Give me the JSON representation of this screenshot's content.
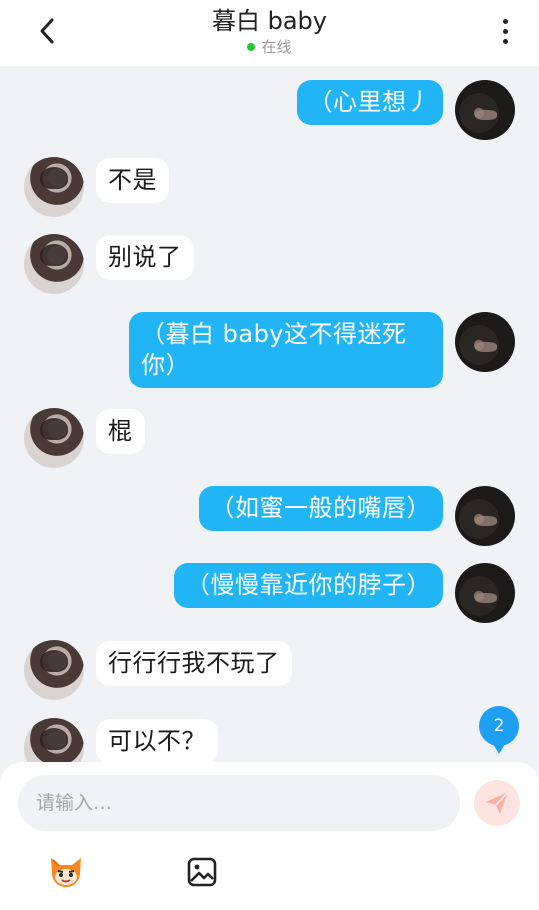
{
  "header": {
    "title": "暮白 baby",
    "status": "在线"
  },
  "messages": [
    {
      "side": "right",
      "text": "（心里想丿"
    },
    {
      "side": "left",
      "text": "不是"
    },
    {
      "side": "left",
      "text": "别说了"
    },
    {
      "side": "right",
      "line1": "（暮白 baby这不得迷死",
      "line2": "你）"
    },
    {
      "side": "left",
      "text": "棍"
    },
    {
      "side": "right",
      "text": "（如蜜一般的嘴唇）"
    },
    {
      "side": "right",
      "text": "（慢慢靠近你的脖子）"
    },
    {
      "side": "left",
      "text": "行行行我不玩了"
    },
    {
      "side": "left",
      "text": "可以不？"
    }
  ],
  "unread_count": "2",
  "composer": {
    "placeholder": "请输入…"
  },
  "colors": {
    "accent": "#21b5f6",
    "online": "#22cc33",
    "badge": "#1ea0f2"
  },
  "icons": {
    "back": "chevron-left-icon",
    "more": "more-vertical-icon",
    "send": "send-icon",
    "sticker": "sticker-icon",
    "image": "image-icon"
  }
}
